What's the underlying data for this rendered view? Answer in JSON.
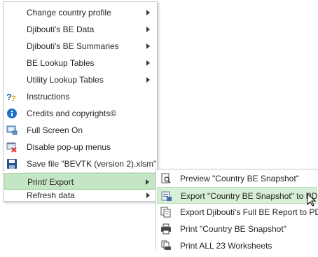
{
  "main_menu": {
    "items": [
      {
        "label": "Change country profile",
        "icon": "",
        "has_submenu": true
      },
      {
        "label": "Djibouti's BE Data",
        "icon": "",
        "has_submenu": true
      },
      {
        "label": "Djibouti's BE Summaries",
        "icon": "",
        "has_submenu": true
      },
      {
        "label": "BE Lookup Tables",
        "icon": "",
        "has_submenu": true
      },
      {
        "label": "Utility Lookup Tables",
        "icon": "",
        "has_submenu": true
      },
      {
        "label": "Instructions",
        "icon": "help-icon",
        "has_submenu": false
      },
      {
        "label": "Credits and copyrights©",
        "icon": "info-icon",
        "has_submenu": false
      },
      {
        "label": "Full Screen On",
        "icon": "fullscreen-icon",
        "has_submenu": false
      },
      {
        "label": "Disable pop-up menus",
        "icon": "disable-popup-icon",
        "has_submenu": false
      },
      {
        "label": "Save file \"BEVTK (version 2).xlsm\"",
        "icon": "save-icon",
        "has_submenu": false
      },
      {
        "label": "Print/ Export",
        "icon": "",
        "has_submenu": true,
        "active": true
      },
      {
        "label": "Refresh data",
        "icon": "",
        "has_submenu": true
      }
    ]
  },
  "sub_menu": {
    "items": [
      {
        "label": "Preview \"Country BE Snapshot\"",
        "icon": "preview-icon"
      },
      {
        "label": "Export \"Country BE Snapshot\" to PDF",
        "icon": "export-pdf-icon",
        "hover": true
      },
      {
        "label": "Export Djibouti's Full BE Report to PDF",
        "icon": "export-report-icon"
      },
      {
        "label": "Print \"Country BE Snapshot\"",
        "icon": "printer-icon"
      },
      {
        "label": "Print ALL 23 Worksheets",
        "icon": "print-all-icon"
      }
    ]
  },
  "colors": {
    "active_bg": "#c5e6c5",
    "info_icon": "#1e6fc7",
    "save_icon": "#2b4f8f"
  }
}
